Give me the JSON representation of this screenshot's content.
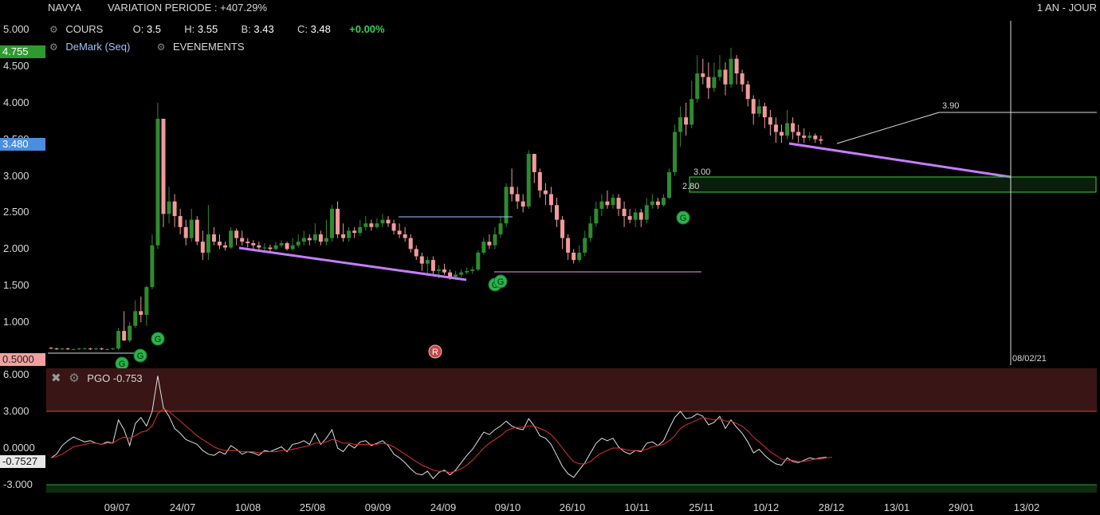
{
  "header": {
    "ticker": "NAVYA",
    "variation": "VARIATION PERIODE : +407.29%",
    "period": "1 AN - JOUR",
    "cours_label": "COURS",
    "open_label": "O:",
    "open": "3.5",
    "high_label": "H:",
    "high": "3.55",
    "low_label": "B:",
    "low": "3.43",
    "close_label": "C:",
    "close": "3.48",
    "change": "+0.00%",
    "indicator_demark": "DeMark (Seq)",
    "indicator_events": "EVENEMENTS"
  },
  "price_axis": {
    "ticks": [
      "5.000",
      "4.500",
      "4.000",
      "3.500",
      "3.000",
      "2.500",
      "2.000",
      "1.500",
      "1.000",
      "0.5000"
    ],
    "tag_high": "4.755",
    "tag_last": "3.480",
    "tag_low": "0.5000"
  },
  "pgo": {
    "title": "PGO -0.753",
    "ticks": [
      "6.000",
      "3.000",
      "0.0000",
      "-3.000"
    ],
    "tag_last": "-0.7527"
  },
  "x_axis": {
    "labels": [
      "09/07",
      "24/07",
      "10/08",
      "25/08",
      "09/09",
      "24/09",
      "09/10",
      "26/10",
      "10/11",
      "25/11",
      "10/12",
      "28/12",
      "13/01",
      "29/01",
      "13/02"
    ]
  },
  "annotations": {
    "target": "3.90",
    "level_300": "3.00",
    "level_280": "2.80",
    "cursor_date": "08/02/21",
    "event_r": "R",
    "g": "G"
  },
  "chart_data": {
    "type": "candlestick",
    "title": "NAVYA",
    "ylim": [
      0.5,
      5.0
    ],
    "up_color": "#2e8b2e",
    "down_color": "#f29a9a",
    "candles": [
      [
        0.65,
        0.64,
        0.66,
        0.63
      ],
      [
        0.64,
        0.63,
        0.65,
        0.62
      ],
      [
        0.63,
        0.64,
        0.65,
        0.62
      ],
      [
        0.64,
        0.63,
        0.65,
        0.62
      ],
      [
        0.63,
        0.63,
        0.64,
        0.62
      ],
      [
        0.63,
        0.64,
        0.65,
        0.62
      ],
      [
        0.64,
        0.64,
        0.65,
        0.63
      ],
      [
        0.64,
        0.63,
        0.65,
        0.62
      ],
      [
        0.63,
        0.64,
        0.65,
        0.62
      ],
      [
        0.64,
        0.63,
        0.65,
        0.62
      ],
      [
        0.63,
        0.63,
        0.64,
        0.62
      ],
      [
        0.63,
        0.64,
        0.65,
        0.62
      ],
      [
        0.64,
        0.88,
        0.92,
        0.62
      ],
      [
        0.88,
        0.75,
        1.15,
        0.74
      ],
      [
        0.75,
        0.95,
        1.0,
        0.72
      ],
      [
        0.95,
        1.15,
        1.3,
        0.92
      ],
      [
        1.15,
        1.1,
        1.35,
        1.0
      ],
      [
        1.1,
        1.48,
        1.5,
        0.95
      ],
      [
        1.48,
        2.05,
        2.2,
        1.45
      ],
      [
        2.05,
        3.78,
        4.0,
        2.0
      ],
      [
        3.78,
        2.48,
        3.78,
        2.3
      ],
      [
        2.48,
        2.65,
        2.85,
        2.35
      ],
      [
        2.65,
        2.45,
        2.75,
        2.3
      ],
      [
        2.45,
        2.3,
        2.55,
        2.2
      ],
      [
        2.3,
        2.15,
        2.4,
        2.05
      ],
      [
        2.15,
        2.4,
        2.55,
        2.1
      ],
      [
        2.4,
        2.1,
        2.45,
        2.05
      ],
      [
        2.1,
        1.95,
        2.25,
        1.85
      ],
      [
        1.95,
        2.2,
        2.6,
        1.85
      ],
      [
        2.2,
        2.1,
        2.3,
        2.05
      ],
      [
        2.1,
        2.05,
        2.2,
        2.0
      ],
      [
        2.05,
        2.02,
        2.1,
        1.98
      ],
      [
        2.02,
        2.25,
        2.3,
        2.0
      ],
      [
        2.25,
        2.15,
        2.28,
        2.05
      ],
      [
        2.15,
        2.1,
        2.25,
        2.05
      ],
      [
        2.1,
        2.08,
        2.15,
        2.02
      ],
      [
        2.08,
        2.05,
        2.12,
        2.0
      ],
      [
        2.05,
        2.02,
        2.1,
        1.98
      ],
      [
        2.02,
        2.02,
        2.08,
        1.98
      ],
      [
        2.02,
        2.0,
        2.06,
        1.96
      ],
      [
        2.0,
        2.05,
        2.1,
        1.98
      ],
      [
        2.05,
        2.08,
        2.12,
        2.02
      ],
      [
        2.08,
        2.0,
        2.1,
        1.98
      ],
      [
        2.0,
        2.05,
        2.15,
        1.98
      ],
      [
        2.05,
        2.1,
        2.2,
        2.02
      ],
      [
        2.1,
        2.15,
        2.25,
        2.05
      ],
      [
        2.15,
        2.12,
        2.2,
        2.05
      ],
      [
        2.12,
        2.2,
        2.35,
        2.08
      ],
      [
        2.2,
        2.1,
        2.25,
        2.05
      ],
      [
        2.1,
        2.15,
        2.4,
        2.05
      ],
      [
        2.15,
        2.55,
        2.6,
        2.1
      ],
      [
        2.55,
        2.2,
        2.65,
        2.15
      ],
      [
        2.2,
        2.15,
        2.35,
        2.1
      ],
      [
        2.15,
        2.25,
        2.3,
        2.1
      ],
      [
        2.25,
        2.22,
        2.3,
        2.15
      ],
      [
        2.22,
        2.3,
        2.4,
        2.18
      ],
      [
        2.3,
        2.35,
        2.45,
        2.25
      ],
      [
        2.35,
        2.3,
        2.4,
        2.25
      ],
      [
        2.3,
        2.35,
        2.42,
        2.28
      ],
      [
        2.35,
        2.4,
        2.48,
        2.3
      ],
      [
        2.4,
        2.35,
        2.45,
        2.3
      ],
      [
        2.35,
        2.25,
        2.4,
        2.2
      ],
      [
        2.25,
        2.2,
        2.35,
        2.15
      ],
      [
        2.2,
        2.15,
        2.3,
        2.1
      ],
      [
        2.15,
        2.0,
        2.2,
        1.95
      ],
      [
        2.0,
        1.9,
        2.05,
        1.85
      ],
      [
        1.9,
        1.8,
        1.95,
        1.7
      ],
      [
        1.8,
        1.85,
        1.9,
        1.65
      ],
      [
        1.85,
        1.7,
        1.9,
        1.65
      ],
      [
        1.7,
        1.72,
        1.78,
        1.6
      ],
      [
        1.72,
        1.68,
        1.8,
        1.65
      ],
      [
        1.68,
        1.62,
        1.72,
        1.58
      ],
      [
        1.62,
        1.65,
        1.7,
        1.58
      ],
      [
        1.65,
        1.68,
        1.72,
        1.62
      ],
      [
        1.68,
        1.7,
        1.75,
        1.65
      ],
      [
        1.7,
        1.72,
        1.76,
        1.66
      ],
      [
        1.72,
        1.95,
        1.98,
        1.7
      ],
      [
        1.95,
        2.1,
        2.15,
        1.92
      ],
      [
        2.1,
        2.05,
        2.2,
        2.0
      ],
      [
        2.05,
        2.2,
        2.3,
        2.0
      ],
      [
        2.2,
        2.35,
        2.45,
        2.15
      ],
      [
        2.35,
        2.85,
        2.9,
        2.3
      ],
      [
        2.85,
        2.75,
        3.1,
        2.65
      ],
      [
        2.75,
        2.65,
        2.85,
        2.55
      ],
      [
        2.65,
        2.58,
        2.75,
        2.5
      ],
      [
        2.58,
        3.3,
        3.35,
        2.55
      ],
      [
        3.3,
        3.05,
        3.3,
        2.9
      ],
      [
        3.05,
        2.8,
        3.1,
        2.7
      ],
      [
        2.8,
        2.75,
        2.9,
        2.6
      ],
      [
        2.75,
        2.6,
        2.85,
        2.5
      ],
      [
        2.6,
        2.4,
        2.7,
        2.3
      ],
      [
        2.4,
        2.15,
        2.45,
        2.0
      ],
      [
        2.15,
        1.95,
        2.2,
        1.85
      ],
      [
        1.95,
        1.85,
        2.0,
        1.8
      ],
      [
        1.85,
        1.95,
        2.05,
        1.82
      ],
      [
        1.95,
        2.15,
        2.25,
        1.9
      ],
      [
        2.15,
        2.35,
        2.45,
        2.1
      ],
      [
        2.35,
        2.55,
        2.65,
        2.3
      ],
      [
        2.55,
        2.65,
        2.75,
        2.45
      ],
      [
        2.65,
        2.6,
        2.8,
        2.55
      ],
      [
        2.6,
        2.7,
        2.75,
        2.55
      ],
      [
        2.7,
        2.55,
        2.75,
        2.45
      ],
      [
        2.55,
        2.45,
        2.65,
        2.3
      ],
      [
        2.45,
        2.4,
        2.55,
        2.35
      ],
      [
        2.4,
        2.5,
        2.55,
        2.3
      ],
      [
        2.5,
        2.4,
        2.55,
        2.3
      ],
      [
        2.4,
        2.6,
        2.7,
        2.35
      ],
      [
        2.6,
        2.65,
        2.75,
        2.55
      ],
      [
        2.65,
        2.6,
        2.7,
        2.55
      ],
      [
        2.6,
        2.7,
        2.75,
        2.58
      ],
      [
        2.7,
        3.05,
        3.1,
        2.68
      ],
      [
        3.05,
        3.6,
        3.7,
        3.0
      ],
      [
        3.6,
        3.8,
        3.95,
        3.4
      ],
      [
        3.8,
        3.7,
        4.0,
        3.55
      ],
      [
        3.7,
        4.05,
        4.3,
        3.65
      ],
      [
        4.05,
        4.4,
        4.65,
        4.0
      ],
      [
        4.4,
        4.35,
        4.6,
        4.25
      ],
      [
        4.35,
        4.2,
        4.55,
        4.05
      ],
      [
        4.2,
        4.35,
        4.55,
        4.15
      ],
      [
        4.35,
        4.45,
        4.65,
        4.3
      ],
      [
        4.45,
        4.25,
        4.55,
        4.1
      ],
      [
        4.25,
        4.6,
        4.75,
        4.2
      ],
      [
        4.6,
        4.4,
        4.65,
        4.25
      ],
      [
        4.4,
        4.25,
        4.45,
        4.15
      ],
      [
        4.25,
        4.05,
        4.3,
        3.95
      ],
      [
        4.05,
        3.85,
        4.1,
        3.7
      ],
      [
        3.85,
        3.95,
        4.05,
        3.8
      ],
      [
        3.95,
        3.8,
        4.0,
        3.65
      ],
      [
        3.8,
        3.7,
        3.9,
        3.55
      ],
      [
        3.7,
        3.6,
        3.8,
        3.45
      ],
      [
        3.6,
        3.55,
        3.7,
        3.45
      ],
      [
        3.55,
        3.72,
        3.9,
        3.5
      ],
      [
        3.72,
        3.6,
        3.8,
        3.5
      ],
      [
        3.6,
        3.55,
        3.7,
        3.45
      ],
      [
        3.55,
        3.52,
        3.65,
        3.45
      ],
      [
        3.52,
        3.55,
        3.6,
        3.48
      ],
      [
        3.55,
        3.5,
        3.58,
        3.45
      ],
      [
        3.5,
        3.48,
        3.55,
        3.43
      ]
    ],
    "pgo_series": [
      {
        "name": "PGO",
        "color": "#e0e0e0",
        "values": [
          -0.8,
          -0.5,
          0.2,
          0.6,
          0.9,
          0.7,
          0.5,
          0.6,
          0.4,
          0.3,
          0.5,
          0.4,
          2.3,
          1.5,
          0.2,
          2.0,
          2.5,
          1.8,
          3.0,
          5.9,
          3.3,
          2.6,
          1.6,
          1.2,
          0.7,
          0.5,
          0.3,
          -0.2,
          -0.5,
          -0.6,
          -0.3,
          -0.5,
          0.2,
          -0.1,
          -0.5,
          -0.3,
          -0.4,
          -0.6,
          -0.2,
          -0.3,
          -0.1,
          0.1,
          -0.3,
          0.3,
          0.4,
          0.6,
          0.3,
          1.2,
          0.3,
          0.8,
          1.5,
          0.0,
          -0.3,
          0.3,
          0.0,
          0.5,
          0.6,
          0.2,
          0.4,
          0.6,
          0.2,
          -0.5,
          -0.8,
          -1.2,
          -1.7,
          -2.1,
          -2.2,
          -1.9,
          -2.5,
          -2.0,
          -1.8,
          -2.2,
          -1.8,
          -1.2,
          -0.6,
          -0.1,
          0.6,
          1.3,
          1.1,
          1.5,
          1.8,
          2.2,
          1.8,
          1.6,
          1.5,
          2.4,
          1.8,
          1.0,
          0.8,
          0.3,
          -0.6,
          -1.5,
          -2.1,
          -2.4,
          -1.8,
          -1.2,
          -0.4,
          0.4,
          0.8,
          0.6,
          0.8,
          0.1,
          -0.3,
          -0.5,
          -0.2,
          -0.3,
          0.4,
          0.5,
          0.2,
          0.6,
          1.6,
          2.5,
          3.0,
          2.4,
          2.5,
          2.8,
          2.6,
          1.9,
          2.1,
          2.6,
          1.6,
          2.3,
          1.7,
          1.2,
          0.5,
          -0.4,
          -0.1,
          -0.6,
          -1.0,
          -1.3,
          -1.4,
          -0.8,
          -1.1,
          -1.2,
          -1.0,
          -0.8,
          -0.9,
          -0.8,
          -0.75
        ]
      },
      {
        "name": "Signal",
        "color": "#e03030",
        "values": [
          -0.8,
          -0.7,
          -0.5,
          -0.2,
          0.1,
          0.2,
          0.3,
          0.4,
          0.4,
          0.3,
          0.4,
          0.4,
          0.7,
          0.9,
          0.8,
          1.0,
          1.3,
          1.4,
          1.8,
          2.8,
          3.2,
          3.0,
          2.6,
          2.2,
          1.8,
          1.4,
          1.0,
          0.7,
          0.4,
          0.1,
          -0.1,
          -0.2,
          -0.2,
          -0.2,
          -0.3,
          -0.3,
          -0.3,
          -0.4,
          -0.3,
          -0.3,
          -0.3,
          -0.2,
          -0.2,
          -0.1,
          0.0,
          0.1,
          0.2,
          0.4,
          0.4,
          0.5,
          0.7,
          0.6,
          0.4,
          0.4,
          0.3,
          0.3,
          0.3,
          0.3,
          0.3,
          0.4,
          0.3,
          0.1,
          -0.2,
          -0.5,
          -0.8,
          -1.1,
          -1.4,
          -1.6,
          -1.8,
          -1.9,
          -1.9,
          -2.0,
          -1.9,
          -1.7,
          -1.4,
          -1.0,
          -0.5,
          0.0,
          0.4,
          0.7,
          1.0,
          1.4,
          1.6,
          1.7,
          1.7,
          1.8,
          1.8,
          1.6,
          1.4,
          1.1,
          0.6,
          0.0,
          -0.6,
          -1.1,
          -1.3,
          -1.3,
          -1.1,
          -0.7,
          -0.4,
          -0.2,
          0.0,
          0.0,
          -0.1,
          -0.2,
          -0.2,
          -0.2,
          -0.1,
          0.1,
          0.2,
          0.3,
          0.6,
          1.0,
          1.6,
          1.9,
          2.1,
          2.3,
          2.5,
          2.4,
          2.3,
          2.4,
          2.2,
          2.2,
          2.0,
          1.8,
          1.4,
          0.9,
          0.5,
          0.1,
          -0.3,
          -0.6,
          -0.9,
          -1.0,
          -1.0,
          -1.1,
          -1.1,
          -1.0,
          -0.9,
          -0.9,
          -0.8,
          -0.75
        ]
      }
    ],
    "pgo_ylim": [
      -3.0,
      6.0
    ],
    "pgo_zones": {
      "overbought": 3.0,
      "oversold": -3.0
    }
  }
}
